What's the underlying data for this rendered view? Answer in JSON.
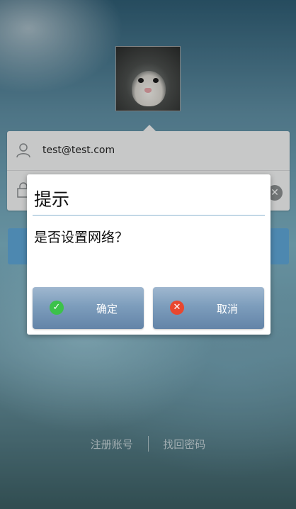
{
  "login": {
    "username": "test@test.com",
    "icons": {
      "user": "user-icon",
      "lock": "lock-icon",
      "clear": "clear-icon"
    }
  },
  "footer": {
    "register_label": "注册账号",
    "recover_label": "找回密码"
  },
  "dialog": {
    "title": "提示",
    "message": "是否设置网络？",
    "ok_label": "确定",
    "cancel_label": "取消",
    "icons": {
      "ok": "check-icon",
      "cancel": "cross-icon"
    }
  },
  "colors": {
    "dialog_button": "#7d9dbc",
    "login_button": "#5fa6d7",
    "ok_icon": "#3cc24a",
    "cancel_icon": "#e9472f"
  }
}
